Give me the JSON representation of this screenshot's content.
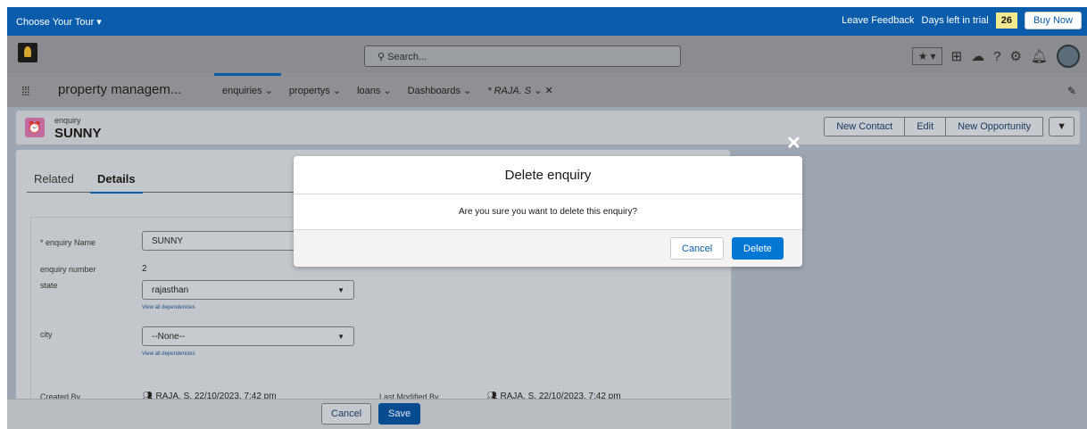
{
  "trial_bar": {
    "tour_label": "Choose Your Tour ▾",
    "feedback_label": "Leave Feedback",
    "days_left_label": "Days left in trial",
    "days_left_value": "26",
    "buy_label": "Buy Now"
  },
  "header": {
    "search_placeholder": "Search...",
    "search_icon": "⚲"
  },
  "nav": {
    "app_name": "property managem...",
    "items": [
      {
        "label": "enquiries ⌄"
      },
      {
        "label": "propertys ⌄"
      },
      {
        "label": "loans ⌄"
      },
      {
        "label": "Dashboards ⌄"
      },
      {
        "label": "* RAJA. S"
      },
      {
        "label": "⌄ ✕"
      }
    ]
  },
  "record": {
    "type": "enquiry",
    "name": "SUNNY",
    "buttons": [
      "New Contact",
      "Edit",
      "New Opportunity"
    ]
  },
  "tabs": {
    "related": "Related",
    "details": "Details"
  },
  "form": {
    "name_label": "* enquiry Name",
    "name_value": "SUNNY",
    "number_label": "enquiry number",
    "number_value": "2",
    "state_label": "state",
    "state_value": "rajasthan",
    "city_label": "city",
    "city_value": "--None--",
    "dependencies_link": "View all dependencies",
    "created_by_label": "Created By",
    "created_by_value": "RAJA. S, 22/10/2023, 7:42 pm",
    "modified_by_label": "Last Modified By",
    "modified_by_value": "RAJA. S, 22/10/2023, 7:42 pm"
  },
  "footer": {
    "cancel": "Cancel",
    "save": "Save"
  },
  "modal": {
    "title": "Delete enquiry",
    "message": "Are you sure you want to delete this enquiry?",
    "cancel": "Cancel",
    "delete": "Delete"
  },
  "colors": {
    "brand": "#0b5cab",
    "primary_button": "#0176d3",
    "record_icon": "#c16aa0",
    "trial_badge": "#f4e98e"
  }
}
